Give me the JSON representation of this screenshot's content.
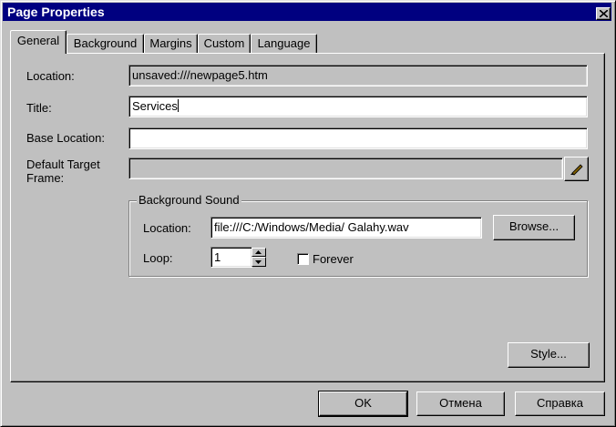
{
  "window": {
    "title": "Page Properties",
    "close_label": "×"
  },
  "tabs": [
    {
      "label": "General",
      "active": true
    },
    {
      "label": "Background",
      "active": false
    },
    {
      "label": "Margins",
      "active": false
    },
    {
      "label": "Custom",
      "active": false
    },
    {
      "label": "Language",
      "active": false
    }
  ],
  "general": {
    "location_label": "Location:",
    "location_value": "unsaved:///newpage5.htm",
    "title_label": "Title:",
    "title_value": "Services",
    "base_location_label": "Base Location:",
    "base_location_value": "",
    "default_target_label_line1": "Default Target",
    "default_target_label_line2": "Frame:",
    "default_target_value": ""
  },
  "background_sound": {
    "group_label": "Background Sound",
    "location_label": "Location:",
    "location_value": "file:///C:/Windows/Media/ Galahy.wav",
    "browse_label": "Browse...",
    "loop_label": "Loop:",
    "loop_value": "1",
    "forever_label": "Forever",
    "forever_checked": false
  },
  "style_button": "Style...",
  "footer": {
    "ok_label": "OK",
    "cancel_label": "Отмена",
    "help_label": "Справка"
  }
}
